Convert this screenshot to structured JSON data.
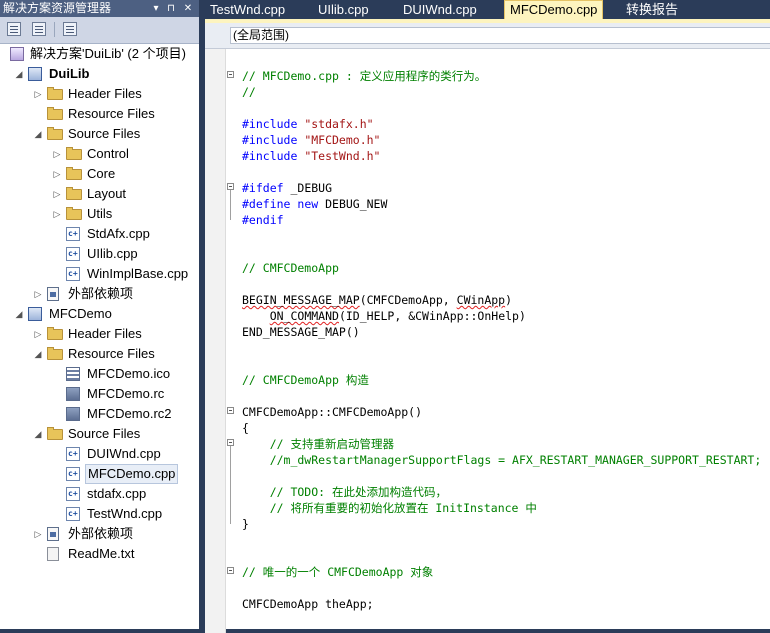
{
  "explorer": {
    "title": "解决方案资源管理器",
    "controls": [
      "▾",
      "⊓",
      "✕"
    ],
    "toolbar": [
      "properties-icon",
      "show-all-files-icon",
      "refresh-icon"
    ]
  },
  "tree": [
    {
      "label": "解决方案'DuiLib' (2 个项目)",
      "icon": "solution",
      "level": 0,
      "expander": ""
    },
    {
      "label": "DuiLib",
      "icon": "project",
      "level": 1,
      "expander": "◢",
      "bold": true
    },
    {
      "label": "Header Files",
      "icon": "folder",
      "level": 2,
      "expander": "▷"
    },
    {
      "label": "Resource Files",
      "icon": "folder",
      "level": 2,
      "expander": ""
    },
    {
      "label": "Source Files",
      "icon": "folder",
      "level": 2,
      "expander": "◢"
    },
    {
      "label": "Control",
      "icon": "folder",
      "level": 3,
      "expander": "▷"
    },
    {
      "label": "Core",
      "icon": "folder",
      "level": 3,
      "expander": "▷"
    },
    {
      "label": "Layout",
      "icon": "folder",
      "level": 3,
      "expander": "▷"
    },
    {
      "label": "Utils",
      "icon": "folder",
      "level": 3,
      "expander": "▷"
    },
    {
      "label": "StdAfx.cpp",
      "icon": "cpp",
      "level": 3,
      "expander": ""
    },
    {
      "label": "UIlib.cpp",
      "icon": "cpp",
      "level": 3,
      "expander": ""
    },
    {
      "label": "WinImplBase.cpp",
      "icon": "cpp",
      "level": 3,
      "expander": ""
    },
    {
      "label": "外部依赖项",
      "icon": "external",
      "level": 2,
      "expander": "▷"
    },
    {
      "label": "MFCDemo",
      "icon": "project",
      "level": 1,
      "expander": "◢"
    },
    {
      "label": "Header Files",
      "icon": "folder",
      "level": 2,
      "expander": "▷"
    },
    {
      "label": "Resource Files",
      "icon": "folder",
      "level": 2,
      "expander": "◢"
    },
    {
      "label": "MFCDemo.ico",
      "icon": "ico",
      "level": 3,
      "expander": ""
    },
    {
      "label": "MFCDemo.rc",
      "icon": "rc",
      "level": 3,
      "expander": ""
    },
    {
      "label": "MFCDemo.rc2",
      "icon": "rc",
      "level": 3,
      "expander": ""
    },
    {
      "label": "Source Files",
      "icon": "folder",
      "level": 2,
      "expander": "◢"
    },
    {
      "label": "DUIWnd.cpp",
      "icon": "cpp",
      "level": 3,
      "expander": ""
    },
    {
      "label": "MFCDemo.cpp",
      "icon": "cpp",
      "level": 3,
      "expander": "",
      "selected": true
    },
    {
      "label": "stdafx.cpp",
      "icon": "cpp",
      "level": 3,
      "expander": ""
    },
    {
      "label": "TestWnd.cpp",
      "icon": "cpp",
      "level": 3,
      "expander": ""
    },
    {
      "label": "外部依赖项",
      "icon": "external",
      "level": 2,
      "expander": "▷"
    },
    {
      "label": "ReadMe.txt",
      "icon": "file",
      "level": 2,
      "expander": ""
    }
  ],
  "tabs": [
    {
      "label": "TestWnd.cpp",
      "active": false
    },
    {
      "label": "UIlib.cpp",
      "active": false
    },
    {
      "label": "DUIWnd.cpp",
      "active": false
    },
    {
      "label": "MFCDemo.cpp",
      "active": true
    },
    {
      "label": "转换报告",
      "active": false
    }
  ],
  "editor": {
    "scope": "(全局范围)",
    "lines": [
      {
        "row": 0,
        "parts": [
          {
            "t": "// MFCDemo.cpp : 定义应用程序的类行为。",
            "c": "com"
          }
        ]
      },
      {
        "row": 1,
        "parts": [
          {
            "t": "//",
            "c": "com"
          }
        ]
      },
      {
        "row": 3,
        "parts": [
          {
            "t": "#include ",
            "c": "kw"
          },
          {
            "t": "\"stdafx.h\"",
            "c": "str"
          }
        ]
      },
      {
        "row": 4,
        "parts": [
          {
            "t": "#include ",
            "c": "kw"
          },
          {
            "t": "\"MFCDemo.h\"",
            "c": "str"
          }
        ]
      },
      {
        "row": 5,
        "parts": [
          {
            "t": "#include ",
            "c": "kw"
          },
          {
            "t": "\"TestWnd.h\"",
            "c": "str"
          }
        ]
      },
      {
        "row": 7,
        "parts": [
          {
            "t": "#ifdef ",
            "c": "kw"
          },
          {
            "t": "_DEBUG",
            "c": "def"
          }
        ]
      },
      {
        "row": 8,
        "parts": [
          {
            "t": "#define ",
            "c": "kw"
          },
          {
            "t": "new ",
            "c": "kw"
          },
          {
            "t": "DEBUG_NEW",
            "c": "def"
          }
        ]
      },
      {
        "row": 9,
        "parts": [
          {
            "t": "#endif",
            "c": "kw"
          }
        ]
      },
      {
        "row": 12,
        "parts": [
          {
            "t": "// CMFCDemoApp",
            "c": "com"
          }
        ]
      },
      {
        "row": 14,
        "parts": [
          {
            "t": "BEGIN_MESSAGE_MAP",
            "c": "sq"
          },
          {
            "t": "(CMFCDemoApp, ",
            "c": "def"
          },
          {
            "t": "CWinApp",
            "c": "sq"
          },
          {
            "t": ")",
            "c": "def"
          }
        ]
      },
      {
        "row": 15,
        "parts": [
          {
            "t": "    ",
            "c": "def"
          },
          {
            "t": "ON_COMMAND",
            "c": "sq"
          },
          {
            "t": "(ID_HELP, &CWinApp::OnHelp)",
            "c": "def"
          }
        ]
      },
      {
        "row": 16,
        "parts": [
          {
            "t": "END_MESSAGE_MAP()",
            "c": "def"
          }
        ]
      },
      {
        "row": 19,
        "parts": [
          {
            "t": "// CMFCDemoApp 构造",
            "c": "com"
          }
        ]
      },
      {
        "row": 21,
        "parts": [
          {
            "t": "CMFCDemoApp::CMFCDemoApp()",
            "c": "def"
          }
        ]
      },
      {
        "row": 22,
        "parts": [
          {
            "t": "{",
            "c": "def"
          }
        ]
      },
      {
        "row": 23,
        "parts": [
          {
            "t": "    // 支持重新启动管理器",
            "c": "com"
          }
        ]
      },
      {
        "row": 24,
        "parts": [
          {
            "t": "    //m_dwRestartManagerSupportFlags = AFX_RESTART_MANAGER_SUPPORT_RESTART;",
            "c": "com"
          }
        ]
      },
      {
        "row": 26,
        "parts": [
          {
            "t": "    // TODO: 在此处添加构造代码，",
            "c": "com"
          }
        ]
      },
      {
        "row": 27,
        "parts": [
          {
            "t": "    // 将所有重要的初始化放置在 InitInstance 中",
            "c": "com"
          }
        ]
      },
      {
        "row": 28,
        "parts": [
          {
            "t": "}",
            "c": "def"
          }
        ]
      },
      {
        "row": 31,
        "parts": [
          {
            "t": "// 唯一的一个 CMFCDemoApp 对象",
            "c": "com"
          }
        ]
      },
      {
        "row": 33,
        "parts": [
          {
            "t": "CMFCDemoApp theApp;",
            "c": "def"
          }
        ]
      }
    ]
  },
  "colors": {
    "frame": "#2b3c59",
    "active_tab": "#fdf4bf",
    "comment": "#008000",
    "keyword": "#0000ff",
    "string": "#a31515"
  }
}
